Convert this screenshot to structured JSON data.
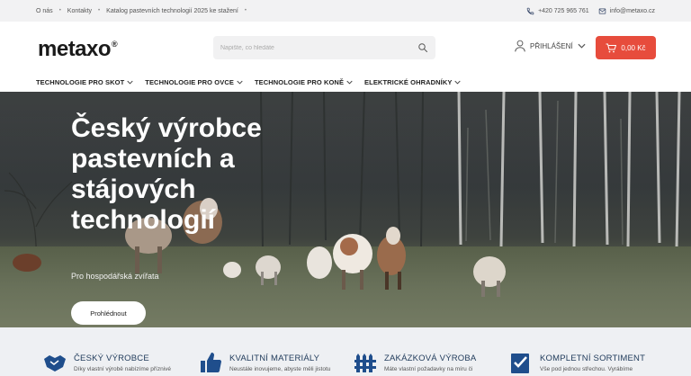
{
  "topbar": {
    "links": [
      "O nás",
      "Kontakty",
      "Katalog pastevních technologií 2025 ke stažení"
    ],
    "phone": "+420 725 965 761",
    "email": "info@metaxo.cz"
  },
  "header": {
    "logo": "metaxo",
    "logo_mark": "®",
    "search_placeholder": "Napište, co hledáte",
    "login_label": "PŘIHLÁŠENÍ",
    "cart_total": "0,00 Kč"
  },
  "nav": {
    "items": [
      "TECHNOLOGIE PRO SKOT",
      "TECHNOLOGIE PRO OVCE",
      "TECHNOLOGIE PRO KONĚ",
      "ELEKTRICKÉ OHRADNÍKY"
    ]
  },
  "hero": {
    "title": "Český výrobce pastevních a stájových technologií",
    "subtitle": "Pro hospodářská zvířata",
    "button": "Prohlédnout"
  },
  "features": [
    {
      "title": "ČESKÝ VÝROBCE",
      "text": "Díky vlastní výrobě nabízíme příznivé",
      "icon": "handshake-icon"
    },
    {
      "title": "KVALITNÍ MATERIÁLY",
      "text": "Neustále inovujeme, abyste měli jistotu",
      "icon": "thumbs-up-icon"
    },
    {
      "title": "ZAKÁZKOVÁ VÝROBA",
      "text": "Máte vlastní požadavky na míru či",
      "icon": "fence-icon"
    },
    {
      "title": "KOMPLETNÍ SORTIMENT",
      "text": "Vše pod jednou střechou. Vyrábíme",
      "icon": "checklist-icon"
    }
  ],
  "colors": {
    "accent": "#e74c3c",
    "feature_blue": "#1f4e8c",
    "topbar_bg": "#f2f2f3"
  }
}
